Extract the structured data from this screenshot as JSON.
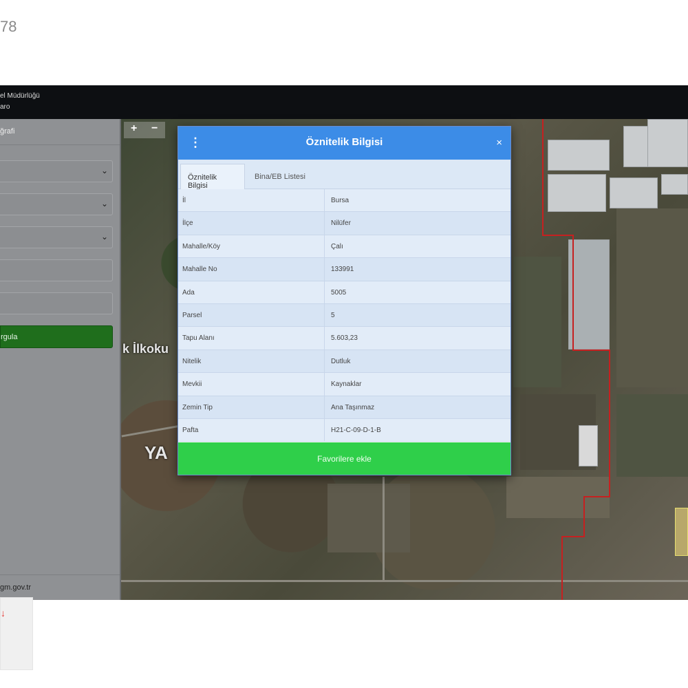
{
  "corner_text": "78",
  "app": {
    "header_line1": "el Müdürlüğü",
    "header_line2": "aro"
  },
  "sidebar": {
    "heading": "ğrafi",
    "selects": [
      {
        "value": ""
      },
      {
        "value": ""
      },
      {
        "value": ""
      }
    ],
    "inputs": [
      {
        "value": ""
      },
      {
        "value": ""
      }
    ],
    "query_button": "rgula",
    "footer": "gm.gov.tr"
  },
  "map": {
    "zoom_in": "+",
    "zoom_out": "−",
    "labels": [
      {
        "text": "k İlkoku"
      },
      {
        "text": "YA"
      }
    ]
  },
  "modal": {
    "menu_icon": "⋮",
    "title": "Öznitelik Bilgisi",
    "close_icon": "×",
    "tabs": [
      {
        "label": "Öznitelik Bilgisi"
      },
      {
        "label": "Bina/EB Listesi"
      }
    ],
    "rows": [
      {
        "key": "İl",
        "value": "Bursa"
      },
      {
        "key": "İlçe",
        "value": "Nilüfer"
      },
      {
        "key": "Mahalle/Köy",
        "value": "Çalı"
      },
      {
        "key": "Mahalle No",
        "value": "133991"
      },
      {
        "key": "Ada",
        "value": "5005"
      },
      {
        "key": "Parsel",
        "value": "5"
      },
      {
        "key": "Tapu Alanı",
        "value": "5.603,23"
      },
      {
        "key": "Nitelik",
        "value": "Dutluk"
      },
      {
        "key": "Mevkii",
        "value": "Kaynaklar"
      },
      {
        "key": "Zemin Tip",
        "value": "Ana Taşınmaz"
      },
      {
        "key": "Pafta",
        "value": "H21-C-09-D-1-B"
      }
    ],
    "favorite_button": "Favorilere ekle"
  },
  "colors": {
    "modal_header": "#3c8ce7",
    "favorite_button": "#2fcf4a",
    "query_button": "#1f6e1c",
    "parcel_boundary": "#c62020"
  }
}
